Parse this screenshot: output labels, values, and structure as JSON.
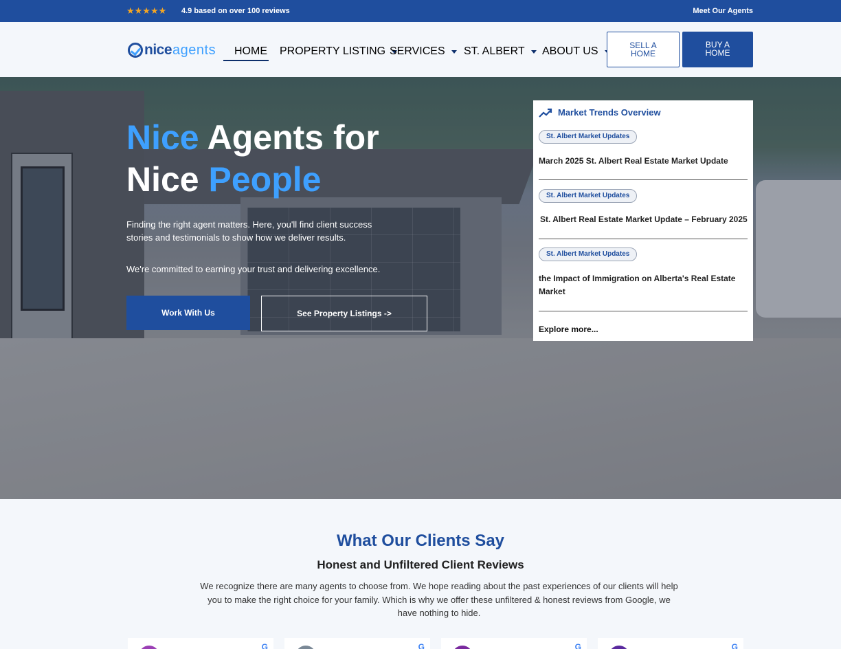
{
  "topbar": {
    "stars": "★★★★★",
    "rating_text": "4.9 based on over 100 reviews",
    "meet_agents": "Meet Our Agents"
  },
  "header": {
    "logo_nice": "nice",
    "logo_agents": "agents",
    "nav": [
      {
        "label": "HOME",
        "dropdown": false,
        "active": true
      },
      {
        "label": "PROPERTY LISTING",
        "dropdown": true
      },
      {
        "label": "SERVICES",
        "dropdown": true
      },
      {
        "label": "ST. ALBERT",
        "dropdown": true
      },
      {
        "label": "ABOUT US",
        "dropdown": true
      }
    ],
    "sell_line1": "SELL A",
    "sell_line2": "HOME",
    "buy_line1": "BUY A",
    "buy_line2": "HOME"
  },
  "hero": {
    "title_hl1": "Nice",
    "title_rest1": " Agents for",
    "title_line2a": "Nice ",
    "title_hl2": "People",
    "text1": "Finding the right agent matters. Here, you'll find client success stories and testimonials to show how we deliver results.",
    "text2": "We're committed to earning your trust and delivering excellence.",
    "work_button": "Work With Us",
    "listings_button": "See Property Listings ->"
  },
  "trends": {
    "title": "Market Trends Overview",
    "items": [
      {
        "tag": "St. Albert Market Updates",
        "title": "March 2025 St. Albert Real Estate Market Update"
      },
      {
        "tag": "St. Albert Market Updates",
        "title": "St. Albert Real Estate Market Update – February 2025"
      },
      {
        "tag": "St. Albert Market Updates",
        "title": "the Impact of Immigration on Alberta's Real Estate Market"
      }
    ],
    "explore": "Explore more..."
  },
  "clients": {
    "title": "What Our Clients Say",
    "subtitle": "Honest and Unfiltered Client Reviews",
    "description": "We recognize there are many agents to choose from. We hope reading about the past experiences of our clients will help you to make the right choice for your family. Which is why we offer these unfiltered & honest reviews from Google, we have nothing to hide.",
    "review_avatar_colors": [
      "#9b3fb5",
      "#7a8896",
      "#7a2a9e",
      "#5a2a9e"
    ],
    "google_mark": "G"
  },
  "colors": {
    "brand_blue": "#1f4e9e",
    "accent_blue": "#3ea0ff",
    "star_gold": "#f5a623"
  }
}
